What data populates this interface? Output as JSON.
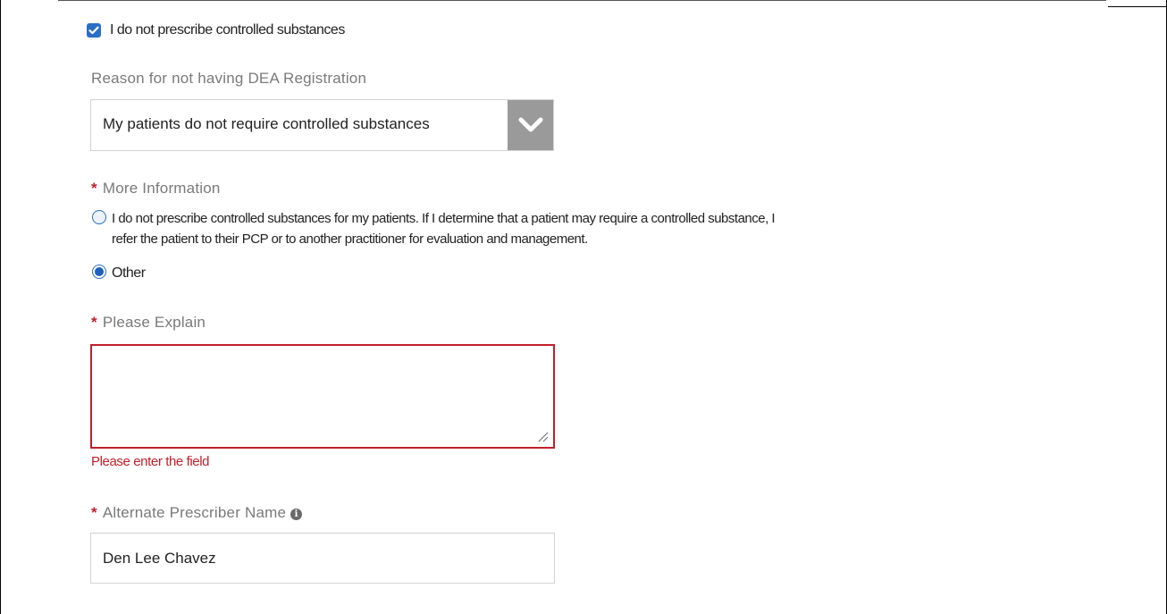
{
  "dea": {
    "checkbox_label": "I do not prescribe controlled substances",
    "checkbox_checked": true
  },
  "reason": {
    "label": "Reason for not having DEA Registration",
    "selected_value": "My patients do not require controlled substances"
  },
  "more_info": {
    "label": "More Information",
    "options": [
      {
        "line1": "I do not prescribe controlled substances for my patients. If I determine that a patient may require a controlled substance, I",
        "line2": "refer the patient to their PCP or to another practitioner for evaluation and management.",
        "selected": false
      },
      {
        "label": "Other",
        "selected": true
      }
    ]
  },
  "explain": {
    "label": "Please Explain",
    "value": "",
    "error": "Please enter the field"
  },
  "alternate_prescriber": {
    "label": "Alternate Prescriber Name",
    "value": "Den Lee Chavez",
    "info_icon": "info-icon"
  },
  "colors": {
    "required": "#c0202b",
    "accent": "#2a6ec8",
    "error": "#c0202b",
    "label_gray": "#7a7a7a"
  },
  "required_marker": "*"
}
